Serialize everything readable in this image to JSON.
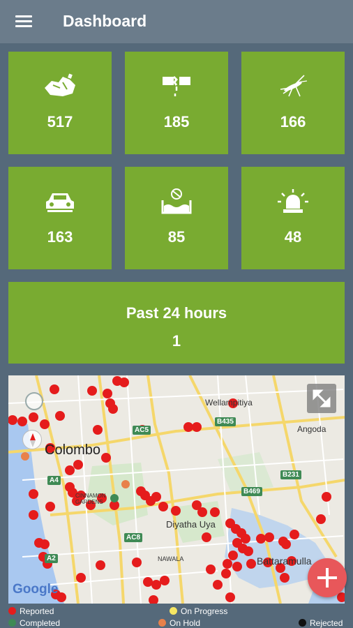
{
  "appbar": {
    "title": "Dashboard"
  },
  "tiles": [
    {
      "icon": "garbage-icon",
      "value": "517"
    },
    {
      "icon": "broken-pipe-icon",
      "value": "185"
    },
    {
      "icon": "mosquito-icon",
      "value": "166"
    },
    {
      "icon": "car-icon",
      "value": "163"
    },
    {
      "icon": "flood-icon",
      "value": "85"
    },
    {
      "icon": "alarm-light-icon",
      "value": "48"
    }
  ],
  "summary": {
    "title": "Past 24 hours",
    "count": "1"
  },
  "map": {
    "labels": {
      "colombo": "Colombo",
      "wellampitiya": "Wellampitiya",
      "angoda": "Angoda",
      "diyatha": "Diyatha Uya",
      "battaramulla": "Battaramulla",
      "gardens": "CINNAMON GARDENS",
      "nawala": "NAWALA"
    },
    "roads": {
      "ac5": "AC5",
      "b435": "B435",
      "a4": "A4",
      "b231": "B231",
      "b469": "B469",
      "ac8": "AC8",
      "a2": "A2"
    },
    "google": "Google"
  },
  "legend": {
    "reported": "Reported",
    "on_progress": "On Progress",
    "completed": "Completed",
    "on_hold": "On Hold",
    "rejected": "Rejected"
  },
  "colors": {
    "tile": "#79ab31",
    "reported": "#e51c1c",
    "on_progress": "#f5e663",
    "completed": "#3f8a55",
    "on_hold": "#e8814a",
    "rejected": "#111111"
  }
}
